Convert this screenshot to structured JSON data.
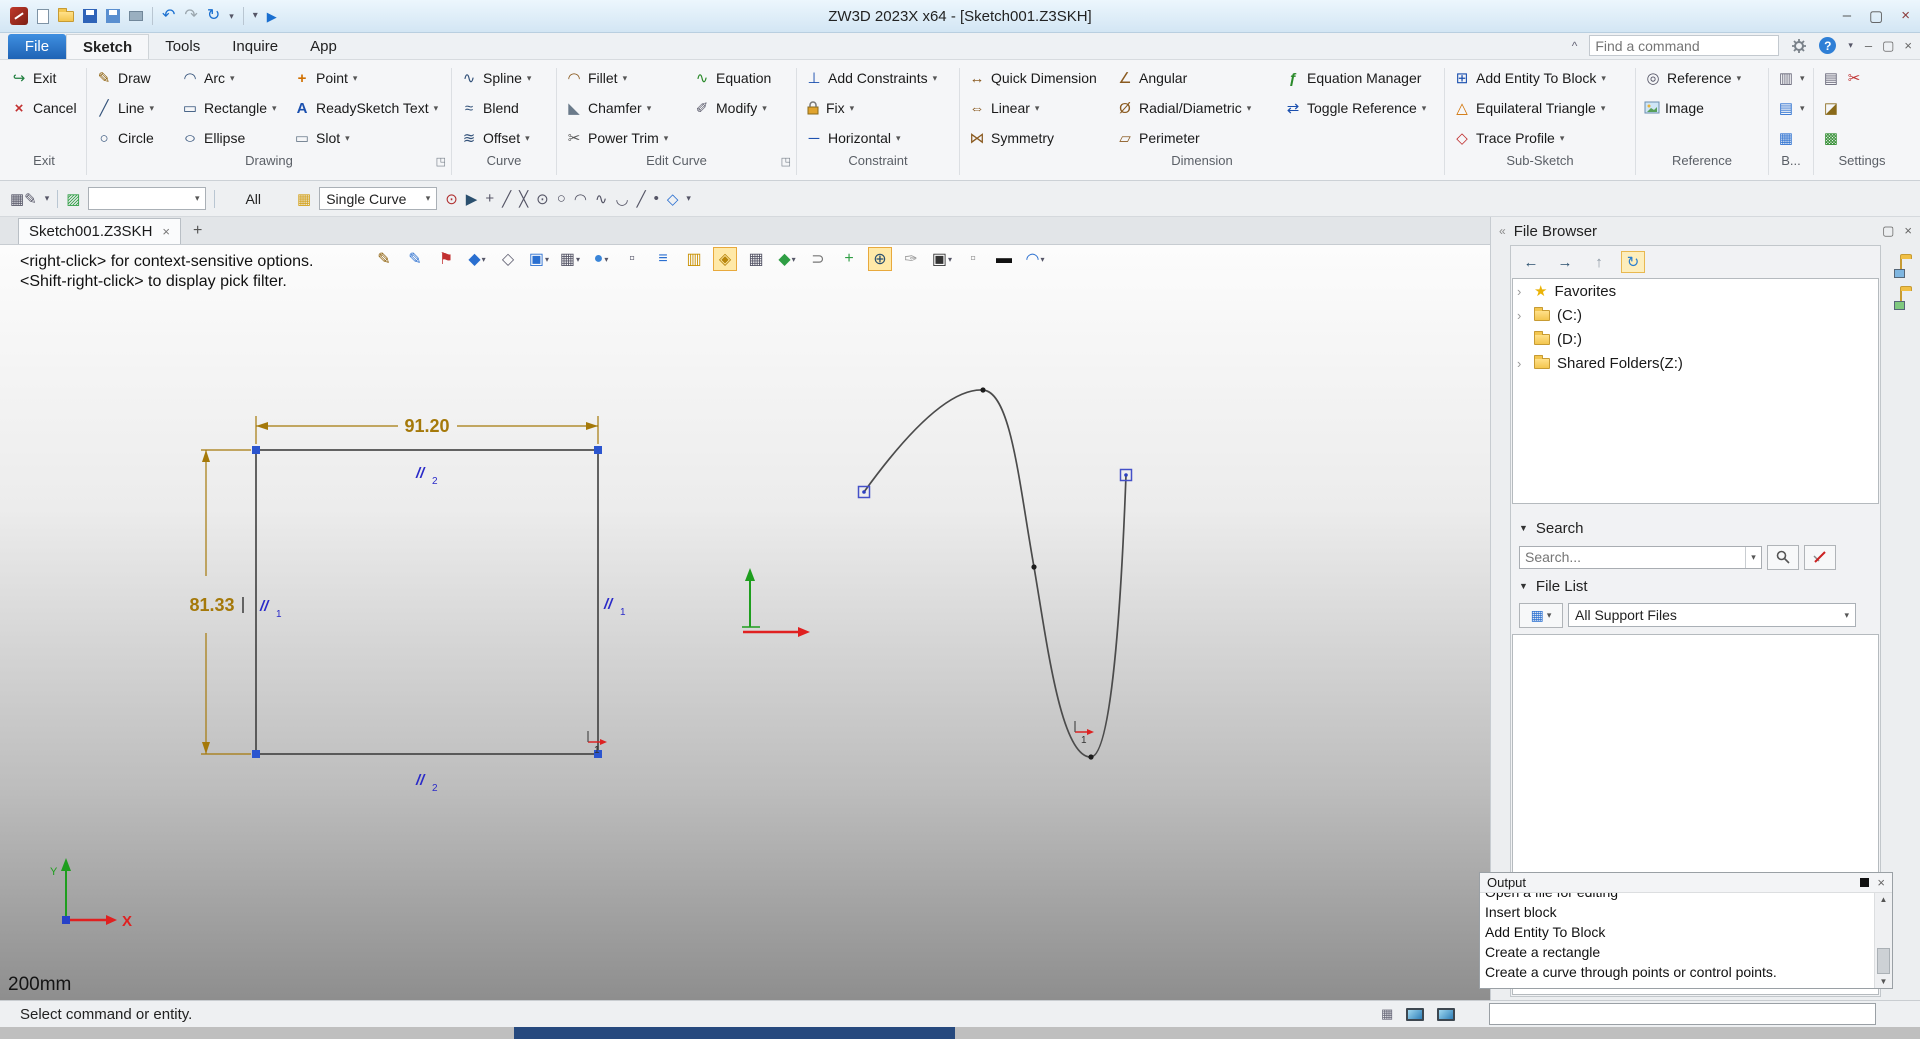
{
  "window": {
    "title": "ZW3D 2023X x64 - [Sketch001.Z3SKH]"
  },
  "menu": {
    "tabs": [
      "File",
      "Sketch",
      "Tools",
      "Inquire",
      "App"
    ],
    "find_placeholder": "Find a command"
  },
  "ribbon": {
    "groups": [
      {
        "label": "Exit",
        "buttons": [
          {
            "label": "Exit"
          },
          {
            "label": "Cancel"
          }
        ]
      },
      {
        "label": "Drawing",
        "buttons": [
          {
            "label": "Draw"
          },
          {
            "label": "Line"
          },
          {
            "label": "Circle"
          },
          {
            "label": "Arc"
          },
          {
            "label": "Rectangle"
          },
          {
            "label": "Ellipse"
          },
          {
            "label": "Point"
          },
          {
            "label": "ReadySketch Text"
          },
          {
            "label": "Slot"
          }
        ]
      },
      {
        "label": "Curve",
        "buttons": [
          {
            "label": "Spline"
          },
          {
            "label": "Blend"
          },
          {
            "label": "Offset"
          }
        ]
      },
      {
        "label": "Edit Curve",
        "buttons": [
          {
            "label": "Fillet"
          },
          {
            "label": "Chamfer"
          },
          {
            "label": "Power Trim"
          },
          {
            "label": "Equation"
          },
          {
            "label": "Modify"
          }
        ]
      },
      {
        "label": "Constraint",
        "buttons": [
          {
            "label": "Add Constraints"
          },
          {
            "label": "Fix"
          },
          {
            "label": "Horizontal"
          }
        ]
      },
      {
        "label": "Dimension",
        "buttons": [
          {
            "label": "Quick Dimension"
          },
          {
            "label": "Linear"
          },
          {
            "label": "Symmetry"
          },
          {
            "label": "Angular"
          },
          {
            "label": "Radial/Diametric"
          },
          {
            "label": "Perimeter"
          },
          {
            "label": "Equation Manager"
          },
          {
            "label": "Toggle Reference"
          }
        ]
      },
      {
        "label": "Sub-Sketch",
        "buttons": [
          {
            "label": "Add Entity To Block"
          },
          {
            "label": "Equilateral Triangle"
          },
          {
            "label": "Trace Profile"
          }
        ]
      },
      {
        "label": "Reference",
        "buttons": [
          {
            "label": "Reference"
          },
          {
            "label": "Image"
          }
        ]
      },
      {
        "label": "B..."
      },
      {
        "label": "Settings"
      }
    ]
  },
  "toolbar": {
    "filter_all": "All",
    "curve_type": "Single Curve"
  },
  "docbar": {
    "tab": "Sketch001.Z3SKH"
  },
  "canvas": {
    "hint_line1": "<right-click> for context-sensitive options.",
    "hint_line2": "<Shift-right-click> to display pick filter.",
    "dim_width": "91.20",
    "dim_height": "81.33",
    "parallel_symbol": "//",
    "constraints": {
      "top": "2",
      "left": "1",
      "right": "1",
      "bottom": "2"
    },
    "point_label": "1",
    "axis_x": "X",
    "axis_y": "Y",
    "scale_label": "200mm"
  },
  "file_browser": {
    "title": "File Browser",
    "tree": [
      {
        "label": "Favorites"
      },
      {
        "label": "(C:)"
      },
      {
        "label": "(D:)"
      },
      {
        "label": "Shared Folders(Z:)"
      }
    ],
    "search": {
      "title": "Search",
      "placeholder": "Search..."
    },
    "file_list": {
      "title": "File List",
      "filter": "All Support Files"
    }
  },
  "output": {
    "title": "Output",
    "clipped_line": "Open a file for editing",
    "lines": [
      "Insert block",
      "Add Entity To Block",
      "Create a rectangle",
      "Create a curve through points or control points."
    ]
  },
  "status": {
    "message": "Select command or entity."
  }
}
